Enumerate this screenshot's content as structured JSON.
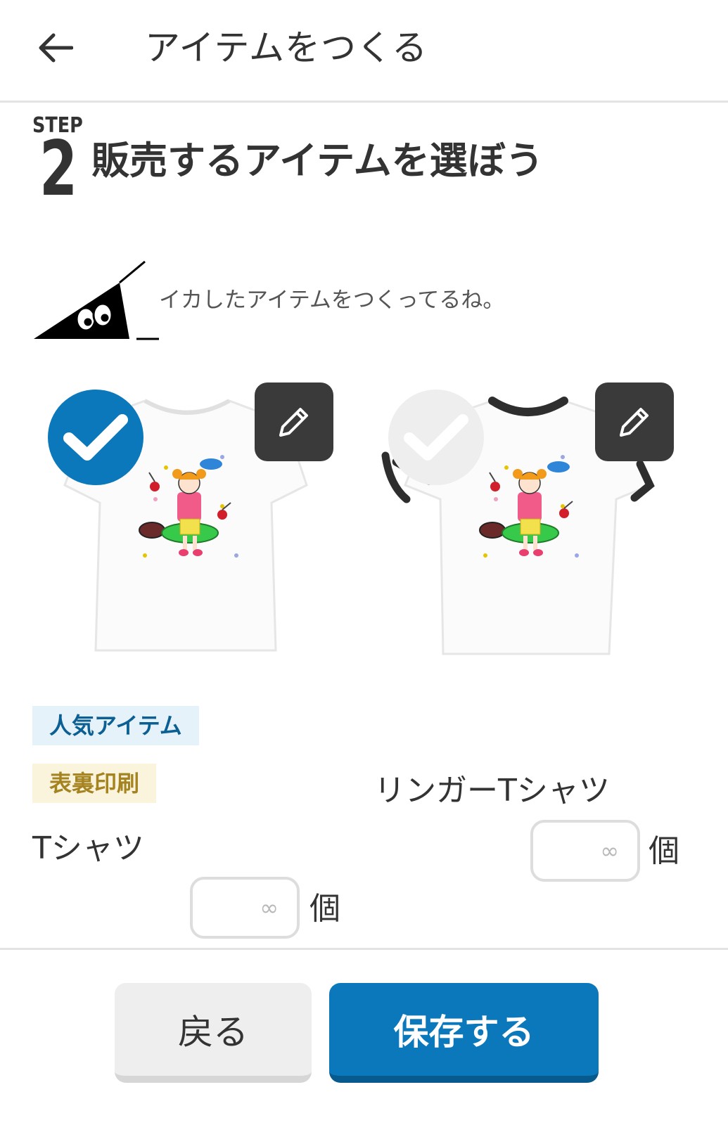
{
  "header": {
    "title": "アイテムをつくる",
    "back_icon": "arrow-left-icon"
  },
  "step": {
    "label": "STEP",
    "number": "2",
    "title": "販売するアイテムを選ぼう"
  },
  "mascot": {
    "message": "イカしたアイテムをつくってるね。"
  },
  "items": [
    {
      "name": "Tシャツ",
      "selected": true,
      "badges": [
        "人気アイテム",
        "表裏印刷"
      ],
      "quantity_placeholder": "∞",
      "unit": "個"
    },
    {
      "name": "リンガーTシャツ",
      "selected": false,
      "badges": [],
      "quantity_placeholder": "∞",
      "unit": "個"
    }
  ],
  "footer": {
    "back_label": "戻る",
    "save_label": "保存する"
  },
  "colors": {
    "accent": "#0b78bc",
    "dark": "#3a3a3a",
    "badge_popular_bg": "#e6f2fa",
    "badge_print_bg": "#fbf4dd"
  }
}
